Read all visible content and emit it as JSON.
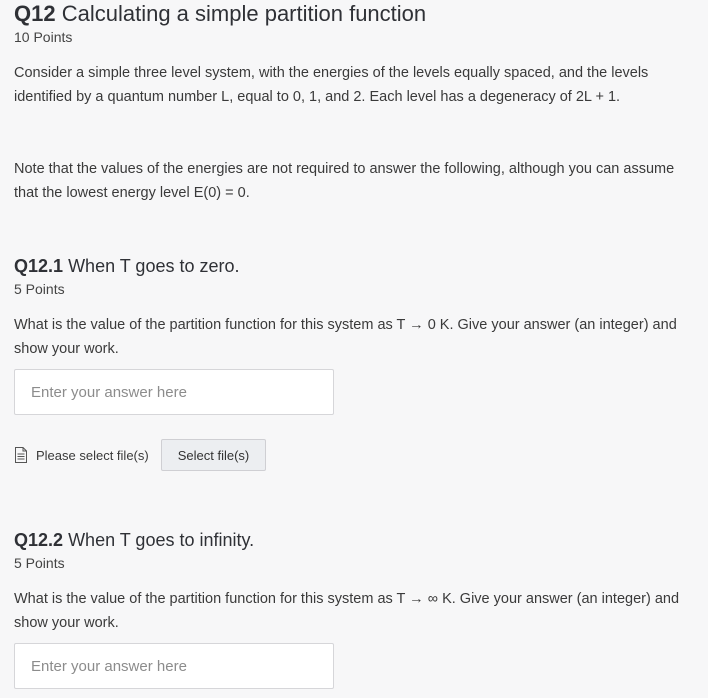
{
  "q12": {
    "number": "Q12",
    "title": "Calculating a simple partition function",
    "points": "10 Points",
    "paragraph1": "Consider a simple three level system, with the energies of the levels equally spaced, and the levels identified by a quantum number L, equal to  0, 1, and 2. Each level has a degeneracy of 2L + 1.",
    "paragraph2": "Note that the values of the energies are not required to answer the following, although you can assume that the lowest energy level E(0) = 0."
  },
  "q12_1": {
    "number": "Q12.1",
    "title": "When T goes to zero.",
    "points": "5 Points",
    "question": "What is the value of the partition function for this system as T → 0 K. Give your answer (an integer) and show your work.",
    "answer_placeholder": "Enter your answer here",
    "answer_value": "",
    "file_label": "Please select file(s)",
    "file_button": "Select file(s)"
  },
  "q12_2": {
    "number": "Q12.2",
    "title": "When T goes to infinity.",
    "points": "5 Points",
    "question": "What is the value of the partition function for this system as T → ∞ K. Give your answer (an integer) and show your work.",
    "answer_placeholder": "Enter your answer here",
    "answer_value": ""
  },
  "icons": {
    "file": "file-icon"
  }
}
